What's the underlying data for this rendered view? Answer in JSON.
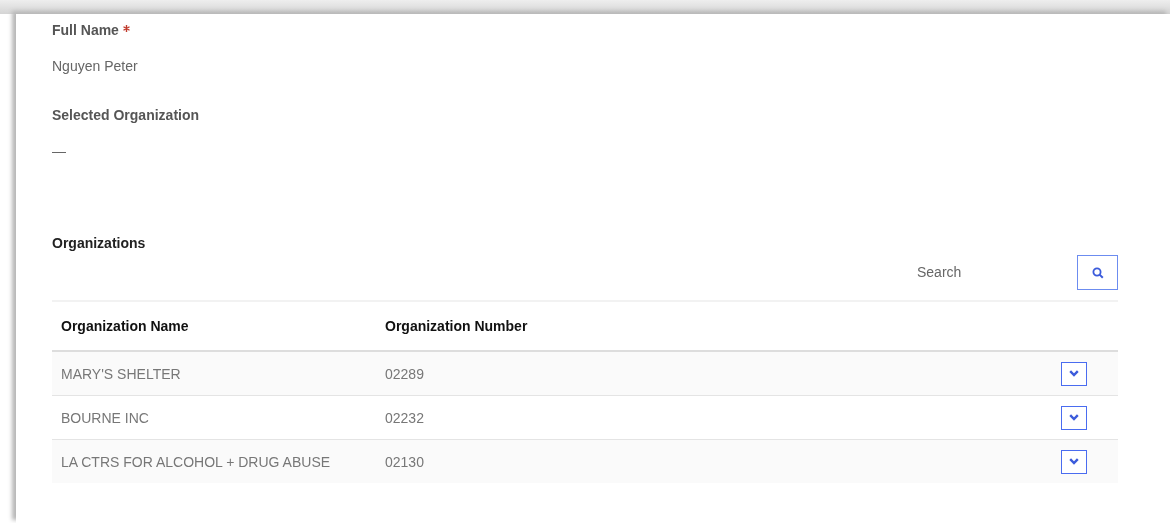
{
  "fields": [
    {
      "label": "Full Name",
      "required": true,
      "value": "Nguyen Peter"
    },
    {
      "label": "Selected Organization",
      "value": "—"
    }
  ],
  "organizations": {
    "title": "Organizations",
    "search": {
      "placeholder": "Search"
    },
    "columns": [
      "Organization Name",
      "Organization Number"
    ],
    "rows": [
      {
        "name": "MARY'S SHELTER",
        "number": "02289"
      },
      {
        "name": "BOURNE INC",
        "number": "02232"
      },
      {
        "name": "LA CTRS FOR ALCOHOL + DRUG ABUSE",
        "number": "02130"
      }
    ]
  }
}
